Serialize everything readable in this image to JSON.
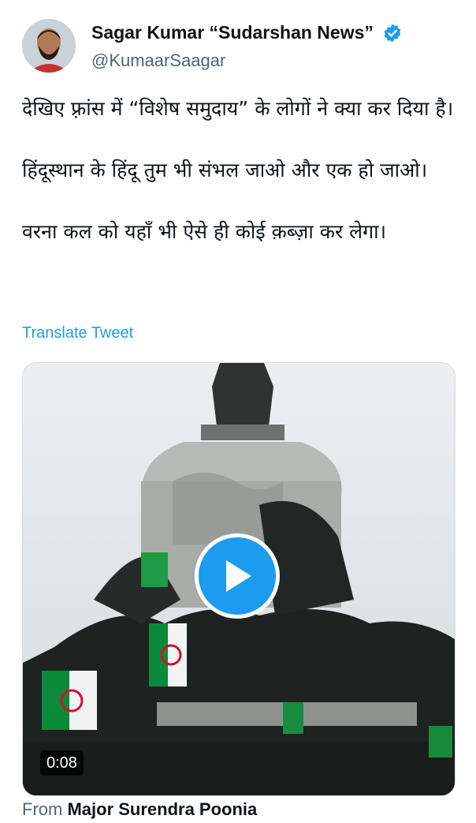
{
  "author": {
    "display_name": "Sagar Kumar “Sudarshan News”",
    "handle": "@KumaarSaagar",
    "verified_icon": "verified-badge-icon",
    "avatar_icon": "user-avatar"
  },
  "tweet": {
    "paragraphs": [
      "देखिए फ़्रांस में “विशेष समुदाय” के लोगों ने क्या कर दिया है।",
      "हिंदूस्थान के हिंदू तुम भी संभल जाओ और एक हो जाओ।",
      "वरना कल को यहाँ भी ऐसे ही कोई क़ब्ज़ा कर लेगा।"
    ],
    "translate_label": "Translate Tweet"
  },
  "media": {
    "duration": "0:08",
    "play_icon": "play-icon",
    "colors": {
      "play_button": "#1d9bf0",
      "flag_green": "#0b8a3a",
      "flag_red": "#d21034"
    }
  },
  "footer": {
    "from_prefix": "From",
    "from_name": "Major Surendra Poonia"
  }
}
